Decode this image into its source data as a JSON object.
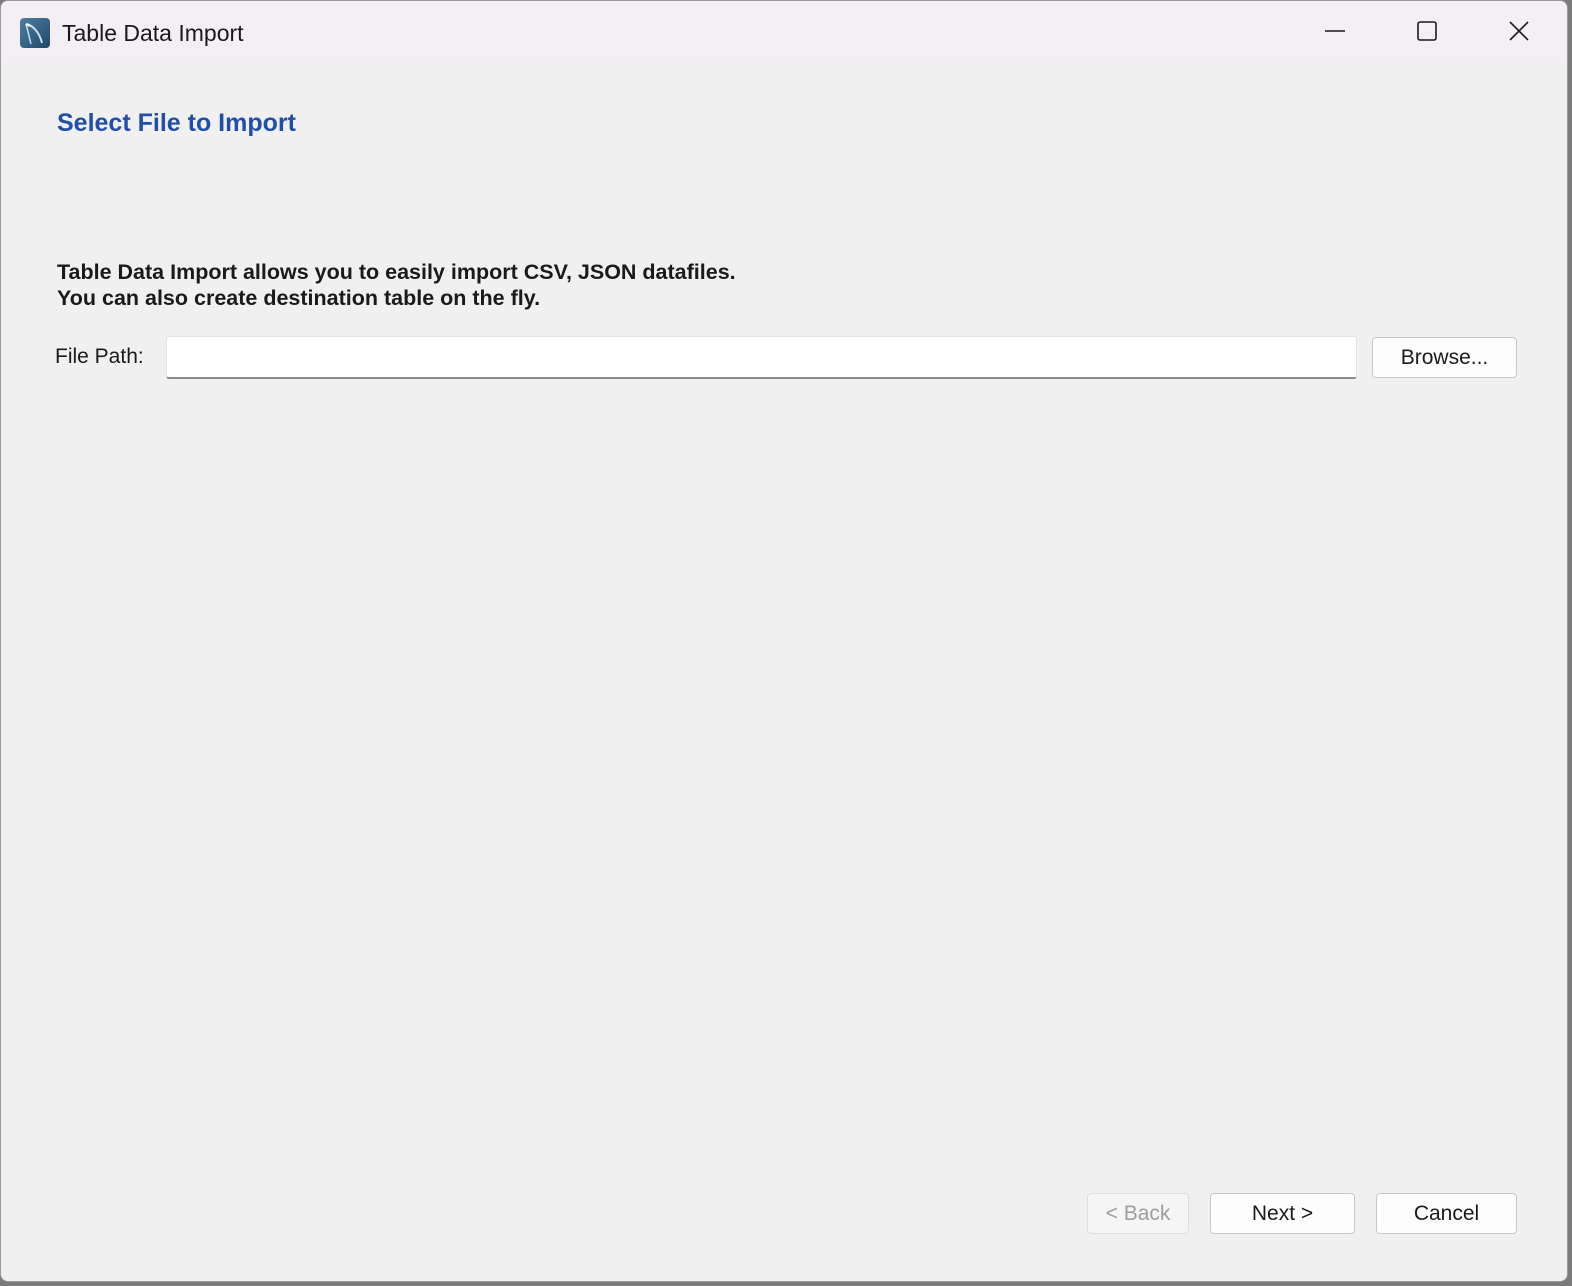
{
  "window": {
    "title": "Table Data Import",
    "icon": "mysql-workbench-icon"
  },
  "controls": {
    "minimize": "minimize-icon",
    "maximize": "maximize-icon",
    "close": "close-icon"
  },
  "page": {
    "heading": "Select File to Import",
    "description_line1": "Table Data Import allows you to easily import CSV, JSON datafiles.",
    "description_line2": "You can also create destination table on the fly."
  },
  "file_path": {
    "label": "File Path:",
    "value": "",
    "placeholder": "",
    "browse_label": "Browse..."
  },
  "footer": {
    "back_label": "< Back",
    "back_enabled": false,
    "next_label": "Next >",
    "cancel_label": "Cancel"
  },
  "colors": {
    "heading": "#1f4fa8",
    "titlebar": "#f3eff5",
    "background": "#f0f0f0"
  }
}
